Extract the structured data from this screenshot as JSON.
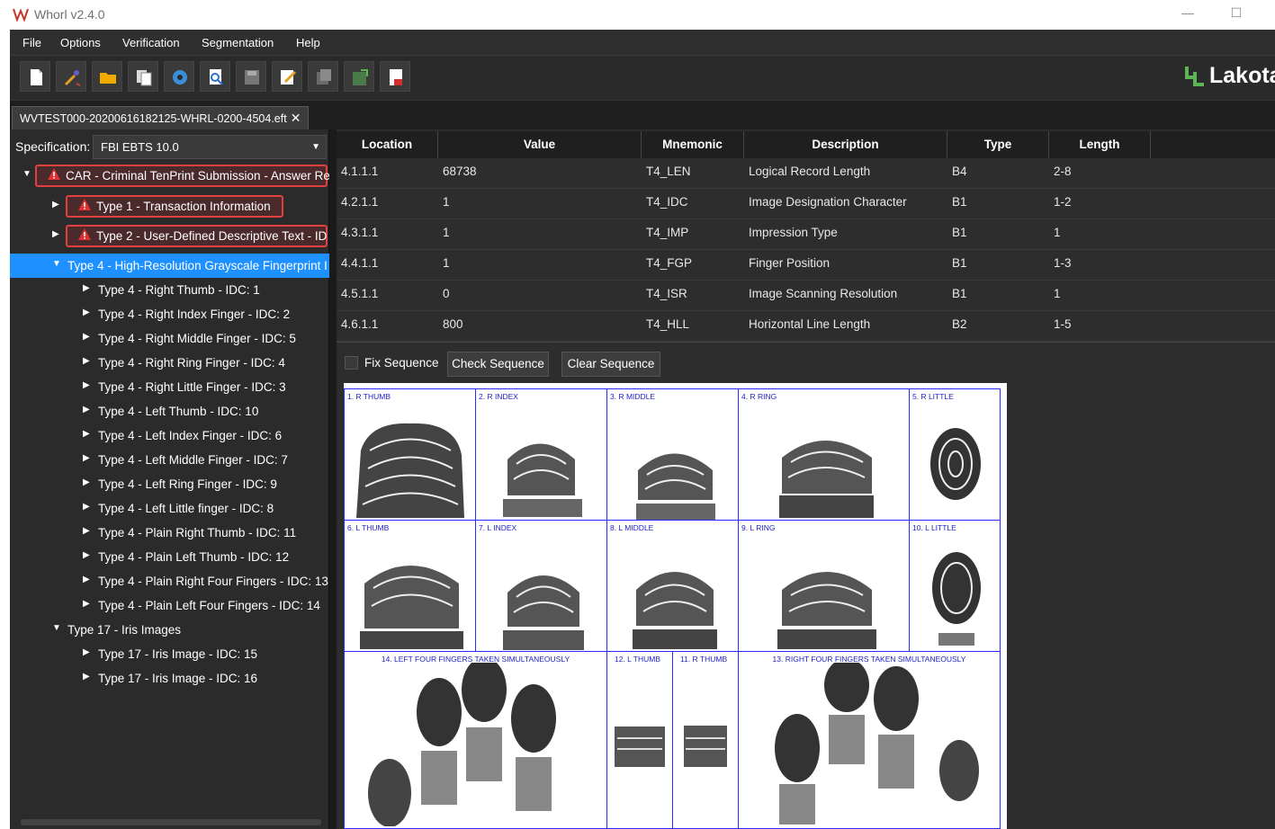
{
  "window": {
    "title": "Whorl v2.4.0",
    "minimize_glyph": "—",
    "maximize_glyph": "☐"
  },
  "menu": [
    "File",
    "Options",
    "Verification",
    "Segmentation",
    "Help"
  ],
  "toolbar": {
    "icons": [
      "new-document-icon",
      "wand-icon",
      "open-folder-icon",
      "copy-icon",
      "settings-gear-icon",
      "preview-icon",
      "save-icon",
      "edit-icon",
      "export-icon",
      "import-icon",
      "report-icon"
    ],
    "brand": "Lakota"
  },
  "file_tab": {
    "label": "WVTEST000-20200616182125-WHRL-0200-4504.eft",
    "close": "✕"
  },
  "specification": {
    "label": "Specification:",
    "value": "FBI EBTS 10.0"
  },
  "tree": [
    {
      "label": "CAR - Criminal TenPrint Submission - Answer Re",
      "level": 0,
      "expanded": true,
      "error": true
    },
    {
      "label": "Type 1 - Transaction Information",
      "level": 1,
      "expanded": false,
      "error": true
    },
    {
      "label": "Type 2 - User-Defined Descriptive Text - ID",
      "level": 1,
      "expanded": false,
      "error": true
    },
    {
      "label": "Type 4 - High-Resolution Grayscale Fingerprint I",
      "level": 1,
      "expanded": true,
      "selected": true
    },
    {
      "label": "Type 4 - Right Thumb - IDC: 1",
      "level": 2
    },
    {
      "label": "Type 4 - Right Index Finger - IDC: 2",
      "level": 2
    },
    {
      "label": "Type 4 - Right Middle Finger - IDC: 5",
      "level": 2
    },
    {
      "label": "Type 4 - Right Ring Finger - IDC: 4",
      "level": 2
    },
    {
      "label": "Type 4 - Right Little Finger - IDC: 3",
      "level": 2
    },
    {
      "label": "Type 4 - Left Thumb - IDC: 10",
      "level": 2
    },
    {
      "label": "Type 4 - Left Index Finger - IDC: 6",
      "level": 2
    },
    {
      "label": "Type 4 - Left Middle Finger - IDC: 7",
      "level": 2
    },
    {
      "label": "Type 4 - Left Ring Finger - IDC: 9",
      "level": 2
    },
    {
      "label": "Type 4 - Left Little finger - IDC: 8",
      "level": 2
    },
    {
      "label": "Type 4 - Plain Right Thumb - IDC: 11",
      "level": 2
    },
    {
      "label": "Type 4 - Plain Left Thumb - IDC: 12",
      "level": 2
    },
    {
      "label": "Type 4 - Plain Right Four Fingers - IDC: 13",
      "level": 2
    },
    {
      "label": "Type 4 - Plain Left Four Fingers - IDC: 14",
      "level": 2
    },
    {
      "label": "Type 17 - Iris Images",
      "level": 1,
      "expanded": true
    },
    {
      "label": "Type 17 - Iris Image - IDC: 15",
      "level": 2
    },
    {
      "label": "Type 17 - Iris Image - IDC: 16",
      "level": 2
    }
  ],
  "table": {
    "columns": [
      "Location",
      "Value",
      "Mnemonic",
      "Description",
      "Type",
      "Length"
    ],
    "rows": [
      [
        "4.1.1.1",
        "68738",
        "T4_LEN",
        "Logical Record Length",
        "B4",
        "2-8"
      ],
      [
        "4.2.1.1",
        "1",
        "T4_IDC",
        "Image Designation Character",
        "B1",
        "1-2"
      ],
      [
        "4.3.1.1",
        "1",
        "T4_IMP",
        "Impression Type",
        "B1",
        "1"
      ],
      [
        "4.4.1.1",
        "1",
        "T4_FGP",
        "Finger Position",
        "B1",
        "1-3"
      ],
      [
        "4.5.1.1",
        "0",
        "T4_ISR",
        "Image Scanning Resolution",
        "B1",
        "1"
      ],
      [
        "4.6.1.1",
        "800",
        "T4_HLL",
        "Horizontal Line Length",
        "B2",
        "1-5"
      ]
    ]
  },
  "sequence": {
    "fix_label": "Fix Sequence",
    "check_label": "Check Sequence",
    "clear_label": "Clear Sequence",
    "fix_checked": false
  },
  "card": {
    "row1": [
      "1. R THUMB",
      "2. R INDEX",
      "3. R MIDDLE",
      "4. R RING",
      "5. R LITTLE"
    ],
    "row2": [
      "6. L THUMB",
      "7. L INDEX",
      "8. L MIDDLE",
      "9. L RING",
      "10. L LITTLE"
    ],
    "row3": [
      "14. LEFT FOUR FINGERS TAKEN SIMULTANEOUSLY",
      "12. L THUMB",
      "11. R THUMB",
      "13. RIGHT FOUR FINGERS TAKEN SIMULTANEOUSLY"
    ]
  },
  "colors": {
    "selection": "#1e90ff",
    "error_border": "#e04040",
    "card_grid": "#2a2aff",
    "brand_green": "#5ab552"
  }
}
